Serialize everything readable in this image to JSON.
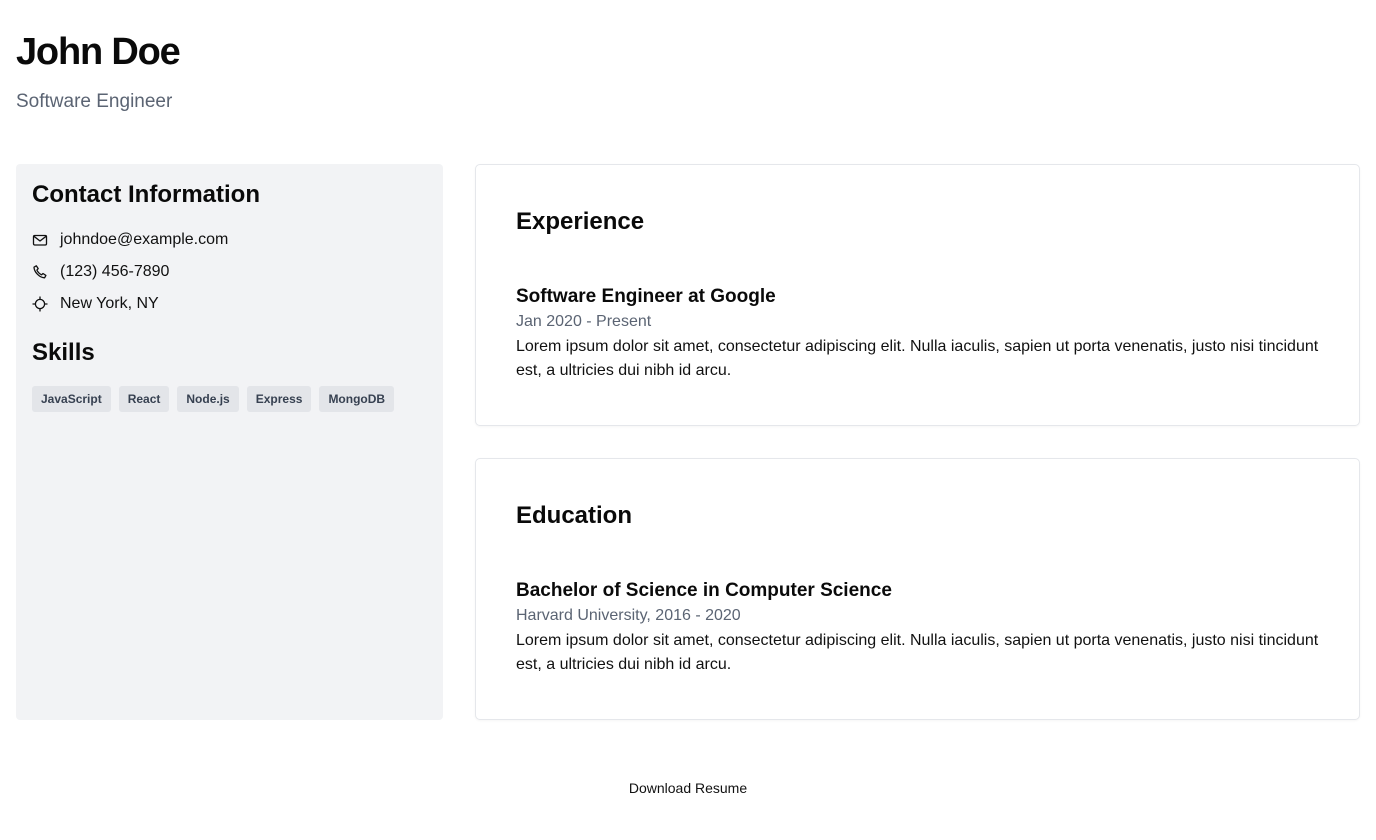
{
  "header": {
    "name": "John Doe",
    "title": "Software Engineer"
  },
  "sidebar": {
    "contact_title": "Contact Information",
    "contact": [
      {
        "icon": "mail-icon",
        "text": "johndoe@example.com"
      },
      {
        "icon": "phone-icon",
        "text": "(123) 456-7890"
      },
      {
        "icon": "location-icon",
        "text": "New York, NY"
      }
    ],
    "skills_title": "Skills",
    "skills": [
      "JavaScript",
      "React",
      "Node.js",
      "Express",
      "MongoDB"
    ]
  },
  "experience": {
    "title": "Experience",
    "role": "Software Engineer at Google",
    "dates": "Jan 2020 - Present",
    "description": "Lorem ipsum dolor sit amet, consectetur adipiscing elit. Nulla iaculis, sapien ut porta venenatis, justo nisi tincidunt est, a ultricies dui nibh id arcu."
  },
  "education": {
    "title": "Education",
    "degree": "Bachelor of Science in Computer Science",
    "school": "Harvard University, 2016 - 2020",
    "description": "Lorem ipsum dolor sit amet, consectetur adipiscing elit. Nulla iaculis, sapien ut porta venenatis, justo nisi tincidunt est, a ultricies dui nibh id arcu."
  },
  "actions": {
    "download_label": "Download Resume"
  },
  "colors": {
    "sidebar_bg": "#f2f3f5",
    "muted_text": "#5b6473",
    "tag_bg": "#e3e5e9",
    "card_border": "#e5e7eb"
  }
}
